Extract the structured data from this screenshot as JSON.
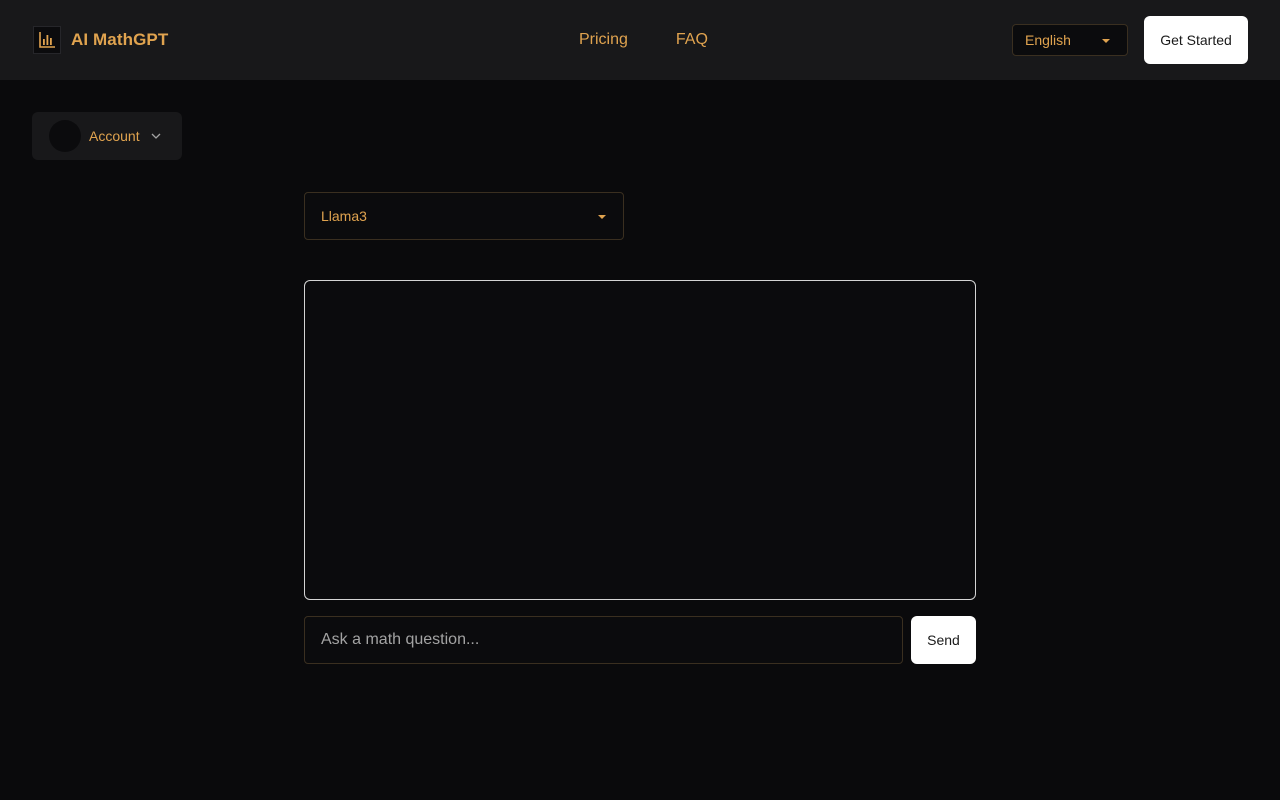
{
  "header": {
    "brand_name": "AI MathGPT",
    "brand_icon": "bar-chart-icon",
    "nav": [
      {
        "label": "Pricing"
      },
      {
        "label": "FAQ"
      }
    ],
    "language": {
      "selected": "English",
      "icon": "caret-down-icon"
    },
    "cta_label": "Get Started"
  },
  "account": {
    "label": "Account",
    "icon": "chevron-down-icon"
  },
  "model": {
    "selected": "Llama3",
    "icon": "caret-down-icon"
  },
  "chat": {
    "messages": []
  },
  "composer": {
    "placeholder": "Ask a math question...",
    "value": "",
    "send_label": "Send"
  },
  "colors": {
    "accent": "#e0a34f",
    "background": "#0a0a0c",
    "header_bg": "#18181a",
    "button_bg": "#ffffff"
  }
}
